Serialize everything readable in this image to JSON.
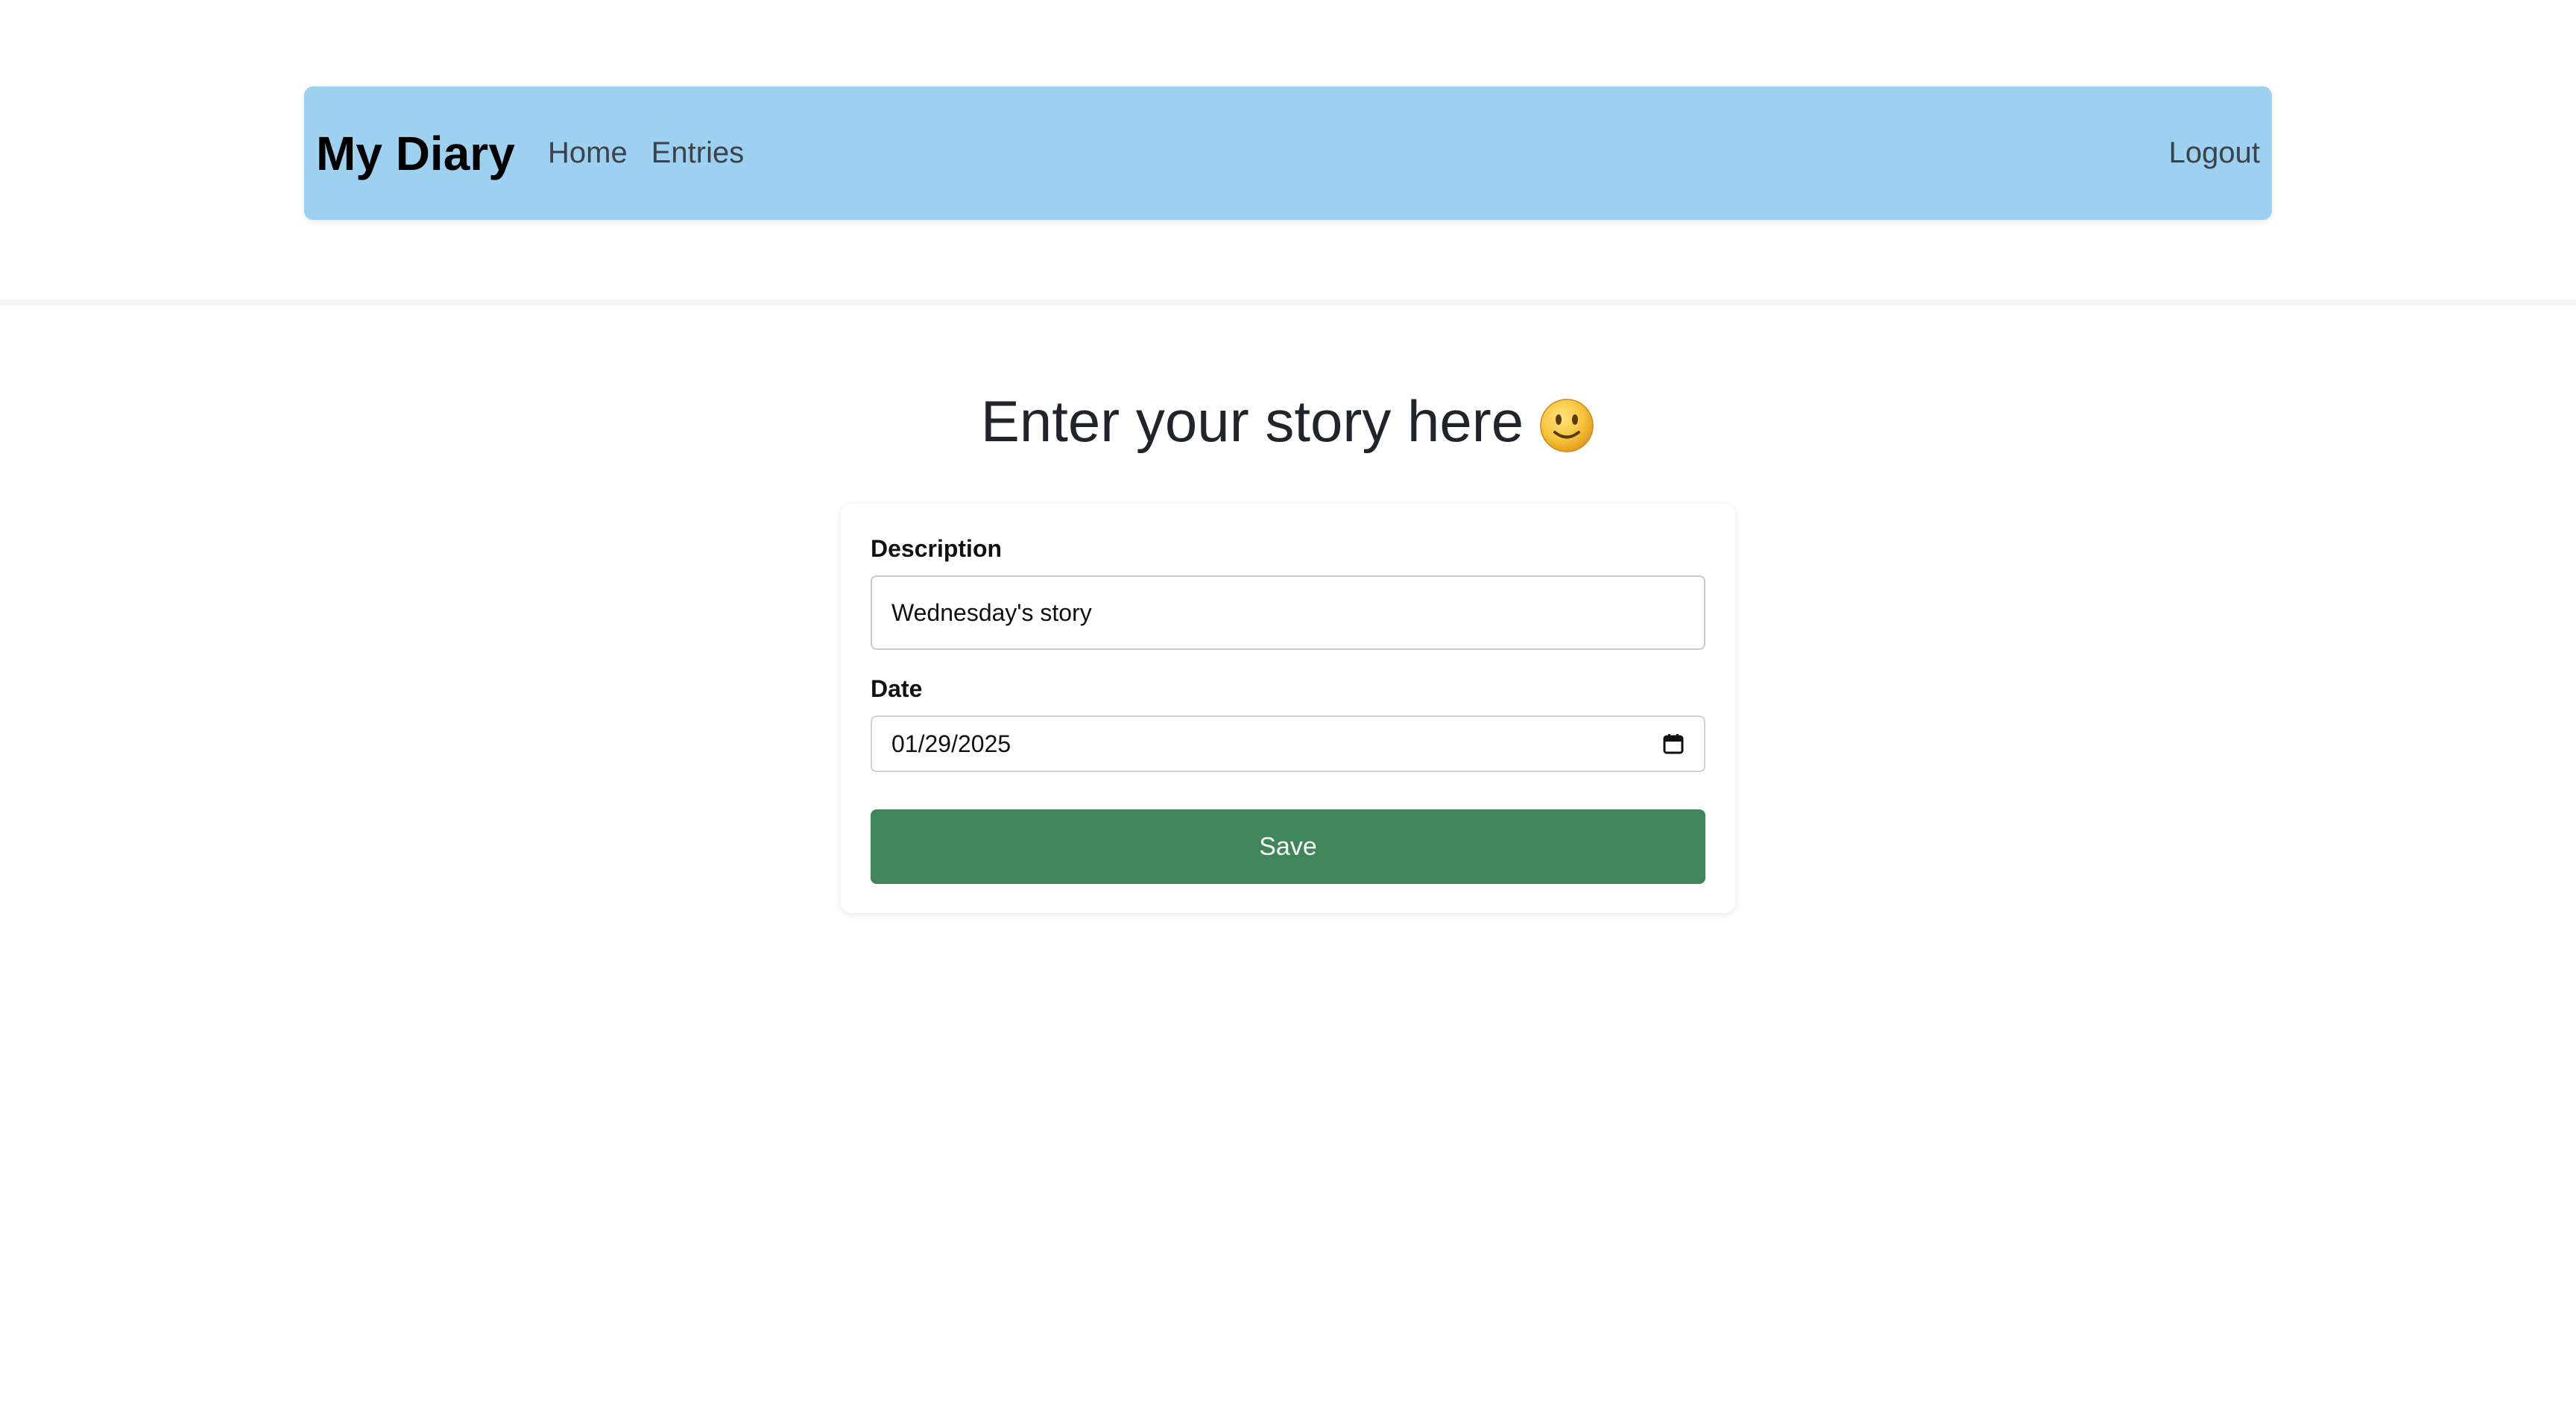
{
  "navbar": {
    "brand": "My Diary",
    "links": [
      {
        "label": "Home"
      },
      {
        "label": "Entries"
      }
    ],
    "logout_label": "Logout",
    "background_color": "#9ed0ef"
  },
  "main": {
    "title": "Enter your story here",
    "title_icon": "smiley-face-icon"
  },
  "form": {
    "description_label": "Description",
    "description_value": "Wednesday's story",
    "date_label": "Date",
    "date_value": "01/29/2025",
    "date_icon": "calendar-icon",
    "save_label": "Save",
    "save_color": "#3f865b"
  }
}
